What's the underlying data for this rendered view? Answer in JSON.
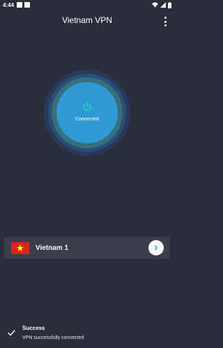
{
  "status_bar": {
    "time": "4:44",
    "icons": [
      "notification-square-icon",
      "notification-square-icon",
      "wifi-icon",
      "signal-icon",
      "battery-icon"
    ]
  },
  "app_bar": {
    "title": "Vietnam VPN",
    "menu_icon": "more-vert-icon"
  },
  "connect_button": {
    "icon": "power-icon",
    "status": "Connected",
    "colors": {
      "core": "#2f9ad3",
      "ring_inner": "#37707d",
      "ring_middle": "#2b4d76",
      "ring_outer": "#283a5c"
    }
  },
  "server": {
    "name": "Vietnam 1",
    "flag": "vietnam-flag",
    "action_icon": "chevron-right-icon"
  },
  "snackbar": {
    "icon": "check-icon",
    "title": "Success",
    "message": "VPN successfully connected"
  },
  "theme": {
    "background": "#2b2e3a",
    "card": "#3a3d4a",
    "accent": "#2f9ad3"
  }
}
